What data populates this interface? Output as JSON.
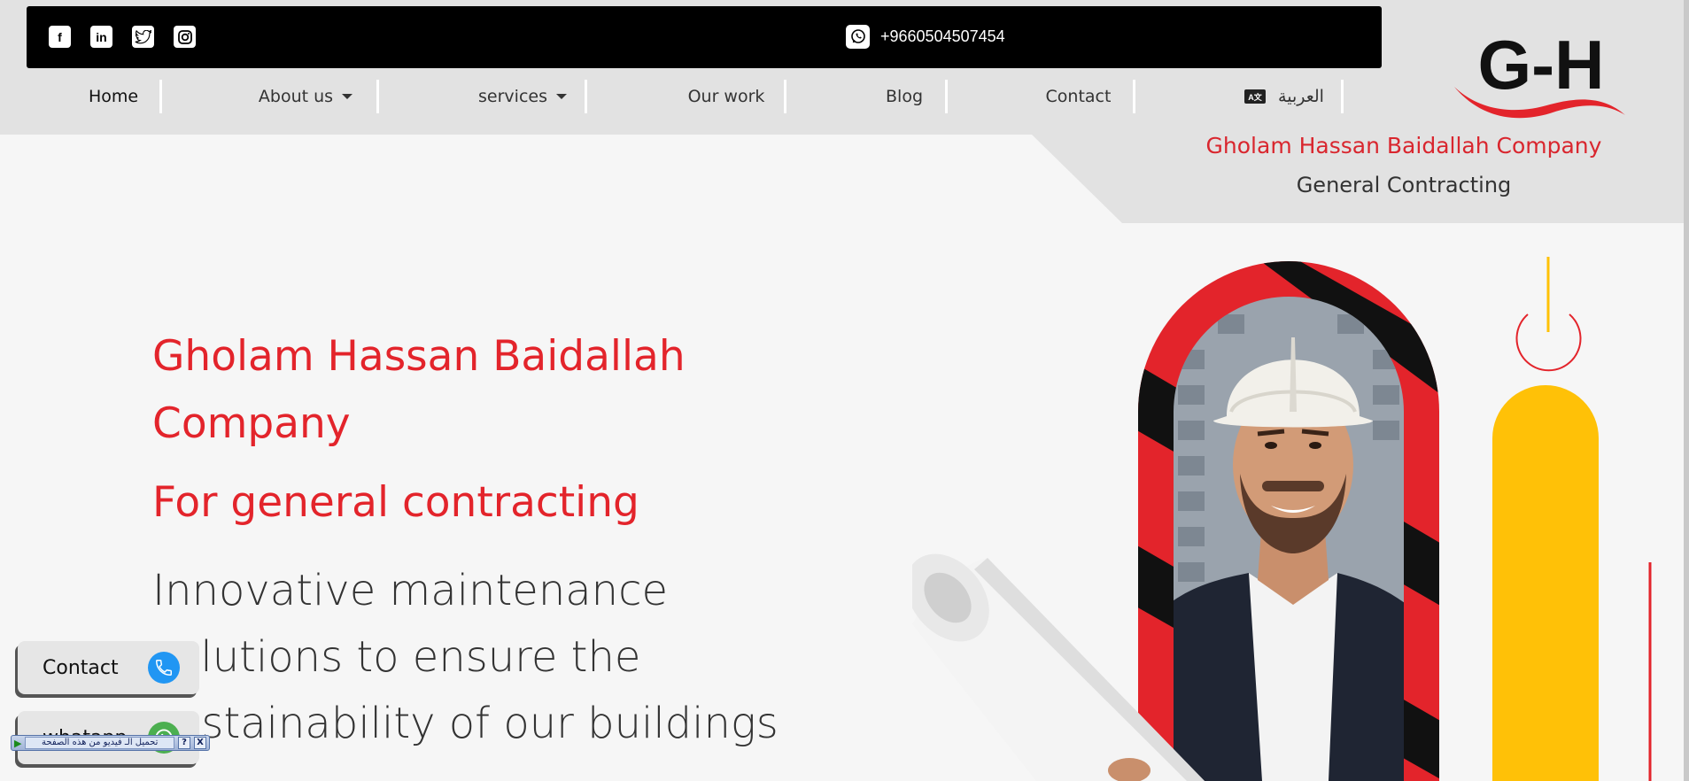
{
  "social": {
    "icons": [
      "facebook-icon",
      "linkedin-icon",
      "twitter-icon",
      "instagram-icon"
    ]
  },
  "topbar": {
    "phone": "+9660504507454",
    "phone_icon": "whatsapp-icon"
  },
  "nav": {
    "home": "Home",
    "about": "About us",
    "services": "services",
    "our_work": "Our work",
    "blog": "Blog",
    "contact": "Contact",
    "language": "العربية",
    "language_icon": "language-icon"
  },
  "brand": {
    "logo_text": "G-H",
    "name": "Gholam Hassan Baidallah Company",
    "tagline": "General Contracting"
  },
  "hero": {
    "title": "Gholam Hassan Baidallah Company",
    "subtitle": "For general contracting",
    "description": "Innovative maintenance solutions to ensure the sustainability of our buildings"
  },
  "floating": {
    "contact_label": "Contact",
    "whatsapp_label": "whatapp"
  },
  "video_bar": {
    "text": "تحميل الـ فيديو من هذه الصفحة",
    "help": "?",
    "close": "X"
  },
  "colors": {
    "accent_red": "#e3242b",
    "accent_yellow": "#ffc107",
    "topbar": "#000000",
    "header_gray": "#e2e2e2"
  }
}
